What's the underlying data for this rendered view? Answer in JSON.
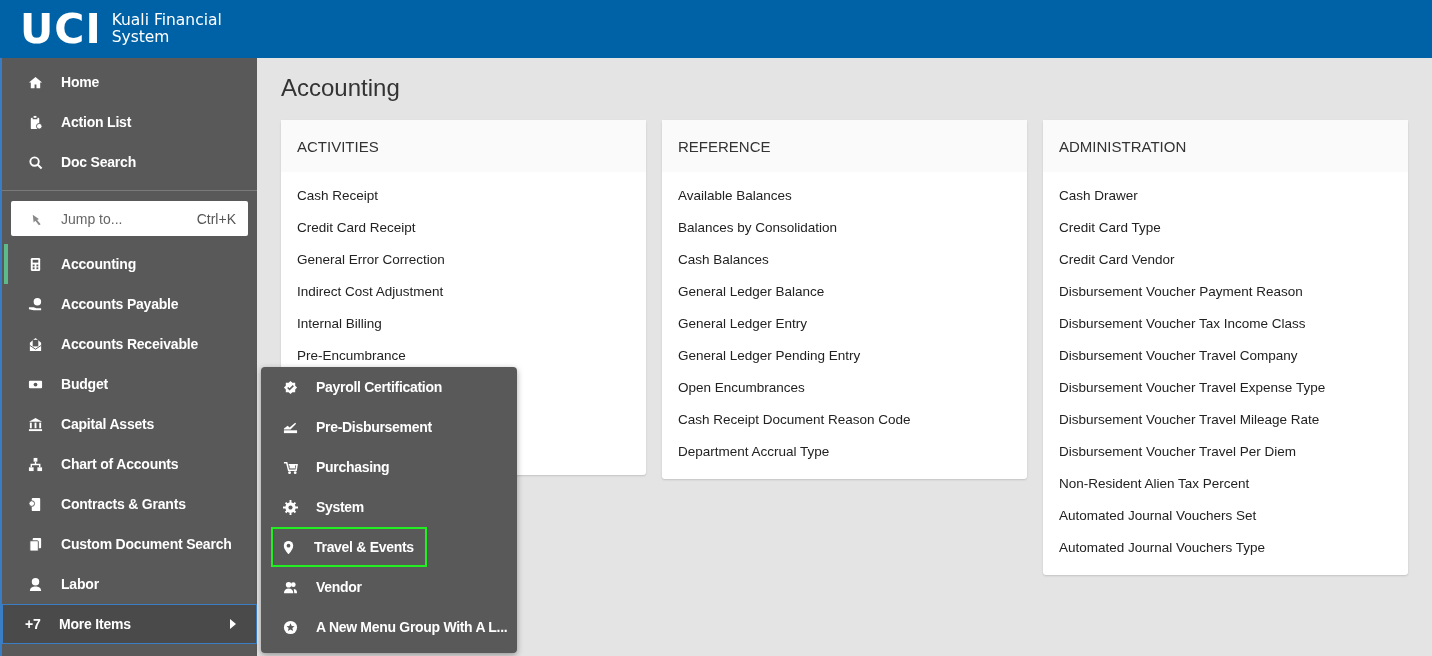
{
  "header": {
    "logo": "UCI",
    "app_name": "Kuali Financial System"
  },
  "sidebar": {
    "top_items": [
      {
        "label": "Home"
      },
      {
        "label": "Action List"
      },
      {
        "label": "Doc Search"
      }
    ],
    "jump": {
      "placeholder": "Jump to...",
      "shortcut": "Ctrl+K"
    },
    "modules": [
      {
        "label": "Accounting",
        "selected": true
      },
      {
        "label": "Accounts Payable",
        "selected": false
      },
      {
        "label": "Accounts Receivable",
        "selected": false
      },
      {
        "label": "Budget",
        "selected": false
      },
      {
        "label": "Capital Assets",
        "selected": false
      },
      {
        "label": "Chart of Accounts",
        "selected": false
      },
      {
        "label": "Contracts & Grants",
        "selected": false
      },
      {
        "label": "Custom Document Search",
        "selected": false
      },
      {
        "label": "Labor",
        "selected": false
      }
    ],
    "more": {
      "count": "+7",
      "label": "More Items"
    }
  },
  "page_title": "Accounting",
  "cards": [
    {
      "title": "ACTIVITIES",
      "items": [
        "Cash Receipt",
        "Credit Card Receipt",
        "General Error Correction",
        "Indirect Cost Adjustment",
        "Internal Billing",
        "Pre-Encumbrance"
      ]
    },
    {
      "title": "REFERENCE",
      "items": [
        "Available Balances",
        "Balances by Consolidation",
        "Cash Balances",
        "General Ledger Balance",
        "General Ledger Entry",
        "General Ledger Pending Entry",
        "Open Encumbrances",
        "Cash Receipt Document Reason Code",
        "Department Accrual Type"
      ]
    },
    {
      "title": "ADMINISTRATION",
      "items": [
        "Cash Drawer",
        "Credit Card Type",
        "Credit Card Vendor",
        "Disbursement Voucher Payment Reason",
        "Disbursement Voucher Tax Income Class",
        "Disbursement Voucher Travel Company",
        "Disbursement Voucher Travel Expense Type",
        "Disbursement Voucher Travel Mileage Rate",
        "Disbursement Voucher Travel Per Diem",
        "Non-Resident Alien Tax Percent",
        "Automated Journal Vouchers Set",
        "Automated Journal Vouchers Type"
      ]
    }
  ],
  "more_menu": {
    "items": [
      {
        "label": "Payroll Certification",
        "highlighted": false
      },
      {
        "label": "Pre-Disbursement",
        "highlighted": false
      },
      {
        "label": "Purchasing",
        "highlighted": false
      },
      {
        "label": "System",
        "highlighted": false
      },
      {
        "label": "Travel & Events",
        "highlighted": true
      },
      {
        "label": "Vendor",
        "highlighted": false
      },
      {
        "label": "A New Menu Group With A L...",
        "highlighted": false
      }
    ]
  }
}
